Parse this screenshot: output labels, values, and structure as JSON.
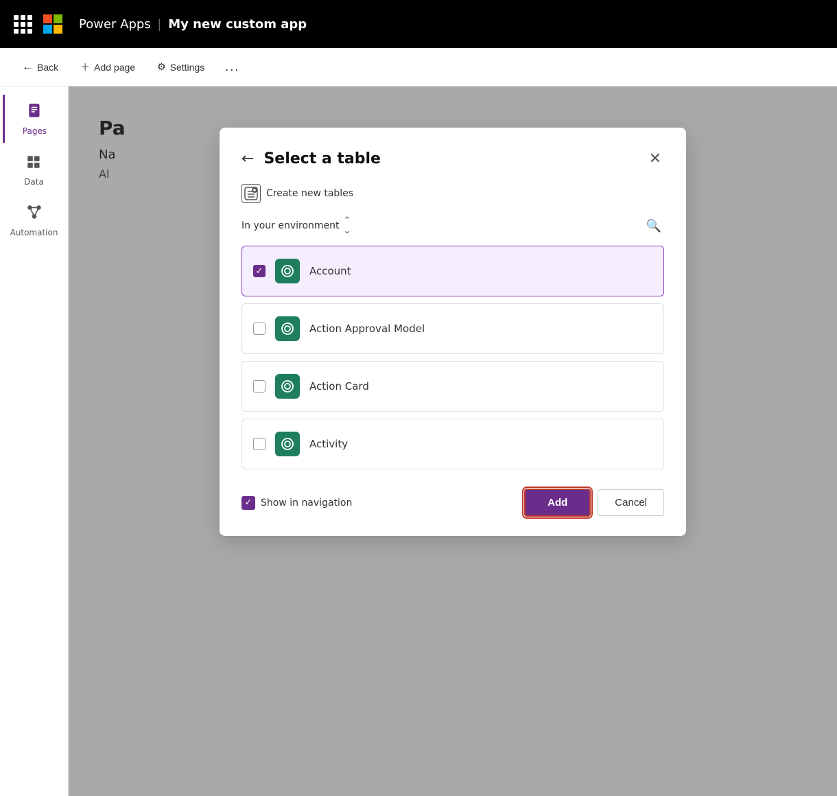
{
  "app": {
    "title": "Microsoft",
    "product": "Power Apps",
    "separator": "|",
    "app_name": "My new custom app"
  },
  "toolbar": {
    "back_label": "Back",
    "add_page_label": "Add page",
    "settings_label": "Settings",
    "more_label": "..."
  },
  "sidebar": {
    "items": [
      {
        "id": "pages",
        "label": "Pages",
        "active": true
      },
      {
        "id": "data",
        "label": "Data",
        "active": false
      },
      {
        "id": "automation",
        "label": "Automation",
        "active": false
      }
    ]
  },
  "background_content": {
    "title_prefix": "Pa",
    "nav_section": "Na",
    "section": "Al"
  },
  "dialog": {
    "title": "Select a table",
    "create_new_tables_label": "Create new tables",
    "environment_label": "In your environment",
    "tables": [
      {
        "id": "account",
        "name": "Account",
        "selected": true
      },
      {
        "id": "action-approval-model",
        "name": "Action Approval Model",
        "selected": false
      },
      {
        "id": "action-card",
        "name": "Action Card",
        "selected": false
      },
      {
        "id": "activity",
        "name": "Activity",
        "selected": false
      }
    ],
    "show_in_navigation_label": "Show in navigation",
    "show_in_navigation_checked": true,
    "add_button_label": "Add",
    "cancel_button_label": "Cancel"
  }
}
